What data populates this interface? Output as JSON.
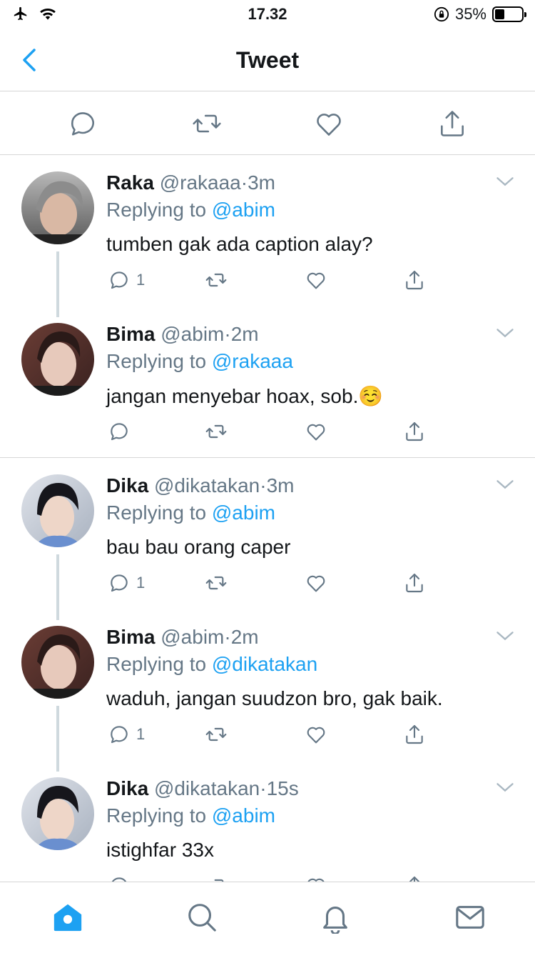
{
  "status": {
    "time": "17.32",
    "battery": "35%",
    "battery_level": 0.35,
    "icons": [
      "airplane-icon",
      "wifi-icon",
      "orientation-lock-icon",
      "battery-icon"
    ]
  },
  "nav": {
    "title": "Tweet",
    "back_icon": "chevron-left-icon"
  },
  "colors": {
    "accent": "#1da1f2",
    "muted": "#657786",
    "text": "#14171a",
    "divider": "#d6d6d6"
  },
  "tweets": [
    {
      "name": "Raka",
      "handle": "@rakaaa",
      "sep": "·",
      "time": "3m",
      "reply_prefix": "Replying to",
      "reply_to": "@abim",
      "text": "tumben gak ada caption alay?",
      "reply_count": "1"
    },
    {
      "name": "Bima",
      "handle": "@abim",
      "sep": "·",
      "time": "2m",
      "reply_prefix": "Replying to",
      "reply_to": "@rakaaa",
      "text": "jangan menyebar hoax, sob.",
      "emoji": "☺️",
      "reply_count": ""
    },
    {
      "name": "Dika",
      "handle": "@dikatakan",
      "sep": "·",
      "time": "3m",
      "reply_prefix": "Replying to",
      "reply_to": "@abim",
      "text": "bau bau orang caper",
      "reply_count": "1"
    },
    {
      "name": "Bima",
      "handle": "@abim",
      "sep": "·",
      "time": "2m",
      "reply_prefix": "Replying to",
      "reply_to": "@dikatakan",
      "text": "waduh, jangan suudzon bro, gak baik.",
      "reply_count": "1"
    },
    {
      "name": "Dika",
      "handle": "@dikatakan",
      "sep": "·",
      "time": "15s",
      "reply_prefix": "Replying to",
      "reply_to": "@abim",
      "text": "istighfar 33x",
      "reply_count": ""
    }
  ],
  "tabs": [
    "home-icon",
    "search-icon",
    "notifications-icon",
    "messages-icon"
  ]
}
